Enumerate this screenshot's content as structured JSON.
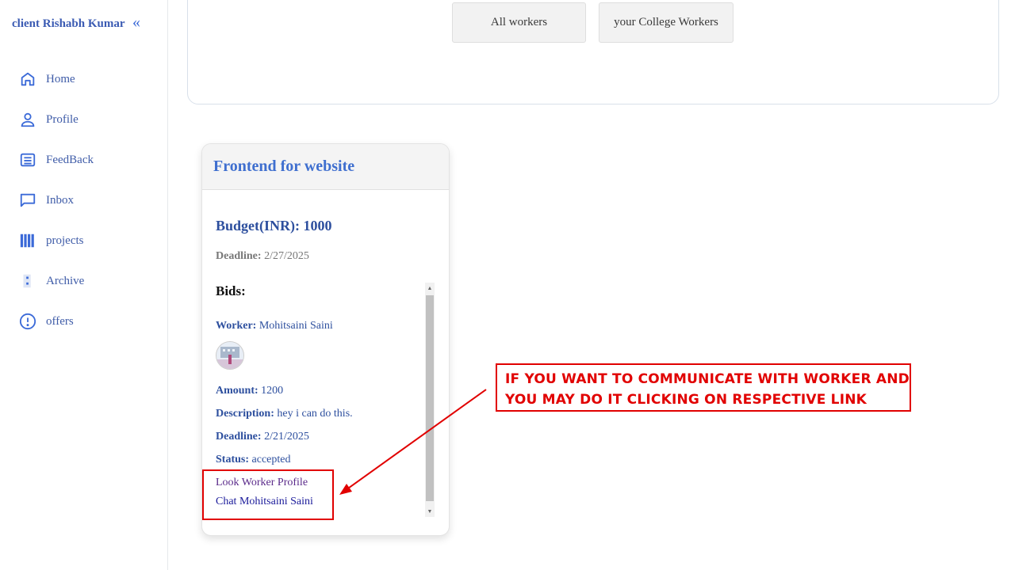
{
  "sidebar": {
    "brand": "client Rishabh Kumar",
    "collapse_glyph": "«",
    "items": [
      {
        "label": "Home",
        "icon": "home-icon"
      },
      {
        "label": "Profile",
        "icon": "user-icon"
      },
      {
        "label": "FeedBack",
        "icon": "feedback-list-icon"
      },
      {
        "label": "Inbox",
        "icon": "chat-bubble-icon"
      },
      {
        "label": "projects",
        "icon": "projects-bars-icon"
      },
      {
        "label": "Archive",
        "icon": "archive-icon"
      },
      {
        "label": "offers",
        "icon": "alert-circle-icon"
      }
    ]
  },
  "top_panel": {
    "buttons": [
      "All workers",
      "your College Workers"
    ]
  },
  "project_card": {
    "title": "Frontend for website",
    "budget_label": "Budget(INR):",
    "budget_value": "1000",
    "deadline_label": "Deadline:",
    "deadline_value": "2/27/2025",
    "bids_heading": "Bids:",
    "bid": {
      "worker_label": "Worker:",
      "worker_name": "Mohitsaini Saini",
      "amount_label": "Amount:",
      "amount_value": "1200",
      "description_label": "Description:",
      "description_value": "hey i can do this.",
      "deadline_label": "Deadline:",
      "deadline_value": "2/21/2025",
      "status_label": "Status:",
      "status_value": "accepted",
      "profile_link": "Look Worker Profile",
      "chat_link": "Chat Mohitsaini Saini"
    }
  },
  "annotation": {
    "line1": "IF YOU WANT TO COMMUNICATE WITH WORKER AND",
    "line2": "YOU MAY DO IT CLICKING ON RESPECTIVE LINK",
    "color": "#e10000"
  },
  "colors": {
    "accent": "#3f6fcf",
    "nav_text": "#3f5ca8"
  }
}
